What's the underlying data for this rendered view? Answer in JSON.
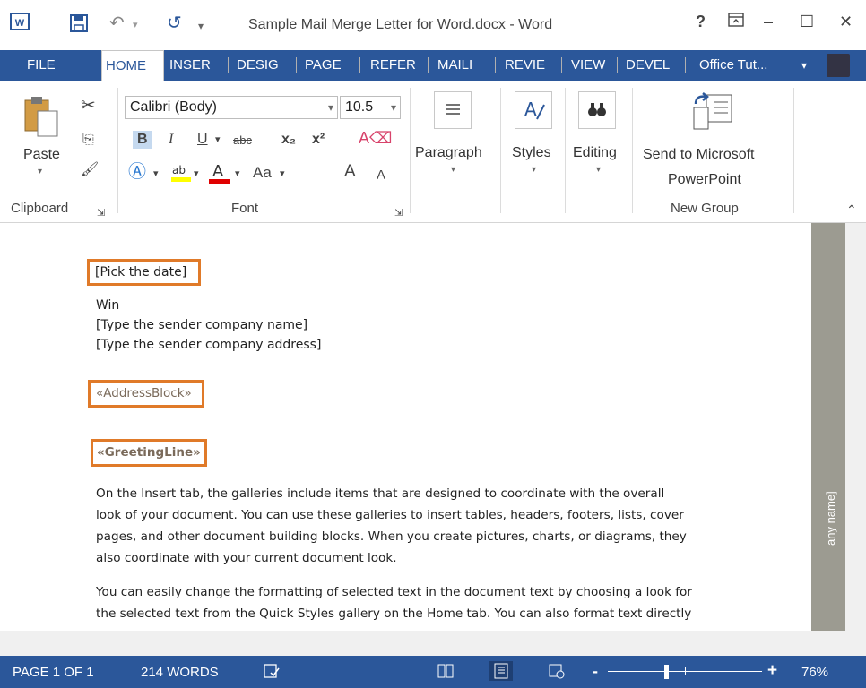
{
  "window": {
    "title": "Sample Mail Merge Letter for Word.docx - Word",
    "help": "?",
    "restore_icon": "ribbon-display-icon",
    "minimize": "–",
    "maximize": "☐",
    "close": "✕"
  },
  "tabs": [
    {
      "label": "FILE"
    },
    {
      "label": "HOME"
    },
    {
      "label": "INSER"
    },
    {
      "label": "DESIG"
    },
    {
      "label": "PAGE"
    },
    {
      "label": "REFER"
    },
    {
      "label": "MAILI"
    },
    {
      "label": "REVIE"
    },
    {
      "label": "VIEW"
    },
    {
      "label": "DEVEL"
    }
  ],
  "user": {
    "name": "Office Tut...",
    "dropdown": "▾"
  },
  "ribbon": {
    "clipboard": {
      "paste": "Paste",
      "label": "Clipboard"
    },
    "font": {
      "family": "Calibri (Body)",
      "size": "10.5",
      "bold": "B",
      "italic": "I",
      "underline": "U",
      "strike": "abc",
      "subscript": "x₂",
      "superscript": "x²",
      "case": "Aa",
      "grow": "A",
      "shrink": "A",
      "label": "Font"
    },
    "paragraph": {
      "label": "Paragraph"
    },
    "styles": {
      "label": "Styles"
    },
    "editing": {
      "label": "Editing"
    },
    "newgroup": {
      "button_line1": "Send to Microsoft",
      "button_line2": "PowerPoint",
      "label": "New Group"
    }
  },
  "document": {
    "date_field": "[Pick the date]",
    "sender_name": "Win",
    "company_name": "[Type the sender company name]",
    "company_address": "[Type the sender company address]",
    "address_block": "«AddressBlock»",
    "greeting_line": "«GreetingLine»",
    "para1": [
      "On the Insert tab, the galleries include items that are designed to coordinate with the overall",
      "look of your document. You can use these galleries to insert tables, headers, footers, lists, cover",
      "pages, and other document building blocks. When you create pictures, charts, or diagrams, they",
      "also coordinate with your current document look."
    ],
    "para2": [
      "You can easily change the formatting of selected text in the document text by choosing a look for",
      "the selected text from the Quick Styles gallery on the Home tab. You can also format text directly"
    ],
    "sidebar_text": "any name]"
  },
  "status": {
    "page": "PAGE 1 OF 1",
    "words": "214 WORDS",
    "zoom": "76%",
    "zoom_minus": "-",
    "zoom_plus": "+"
  },
  "colors": {
    "accent": "#2b579a",
    "highlight_border": "#e07a29"
  }
}
